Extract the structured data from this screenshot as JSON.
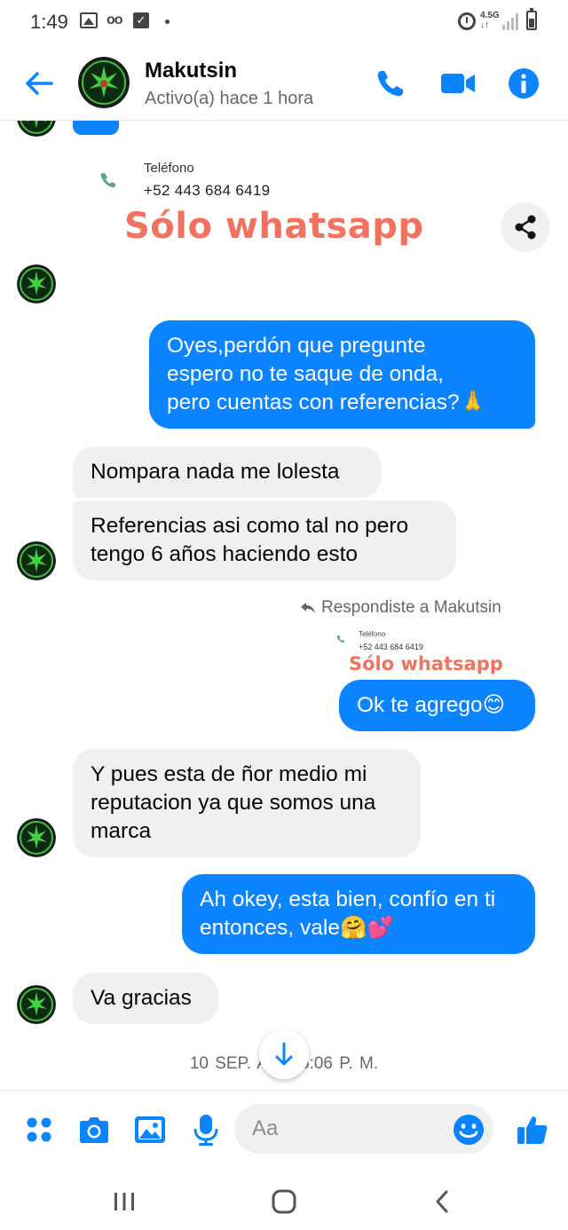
{
  "status_bar": {
    "time": "1:49",
    "network": "4.5G"
  },
  "header": {
    "contact_name": "Makutsin",
    "contact_status": "Activo(a) hace 1 hora",
    "accent_color": "#0a84ff"
  },
  "shared_card": {
    "phone_label": "Teléfono",
    "phone_number": "+52 443 684 6419",
    "title": "Sólo whatsapp"
  },
  "messages": [
    {
      "from": "me",
      "text": "Oyes,perdón que pregunte\nespero no te saque de onda,\npero cuentas con referencias?🙏"
    },
    {
      "from": "contact",
      "text": "Nompara nada me lolesta"
    },
    {
      "from": "contact",
      "text": "Referencias asi como tal no pero\ntengo 6 años haciendo esto"
    },
    {
      "from": "me",
      "text": "Ok te agrego😊"
    },
    {
      "from": "contact",
      "text": "Y pues esta de ñor medio mi\nreputacion ya que somos una\nmarca"
    },
    {
      "from": "me",
      "text": "Ah okey, esta bien, confío en ti\nentonces, vale🤗💕"
    },
    {
      "from": "contact",
      "text": "Va gracias"
    }
  ],
  "reply": {
    "note": "Respondiste a Makutsin",
    "quoted_phone_label": "Teléfono",
    "quoted_phone_number": "+52 443 684 6419",
    "quoted_title": "Sólo whatsapp"
  },
  "timestamp": {
    "left": "10 SEP. A",
    "right": "6:06 P. M."
  },
  "composer": {
    "placeholder": "Aa"
  }
}
